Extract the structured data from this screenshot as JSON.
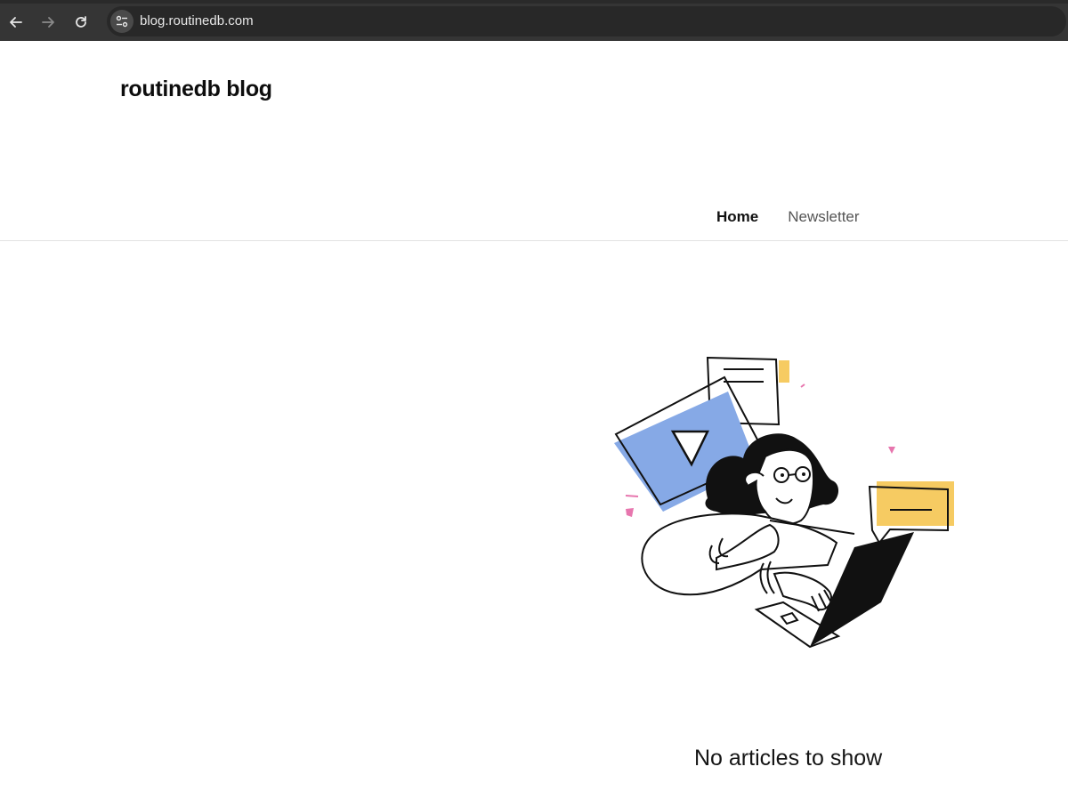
{
  "browser": {
    "url": "blog.routinedb.com",
    "back_icon": "arrow-left-icon",
    "forward_icon": "arrow-right-icon",
    "reload_icon": "reload-icon",
    "site_info_icon": "tune-icon"
  },
  "header": {
    "title": "routinedb blog",
    "nav": [
      {
        "label": "Home",
        "active": true
      },
      {
        "label": "Newsletter",
        "active": false
      }
    ]
  },
  "main": {
    "empty_message": "No articles to show",
    "illustration_icon": "person-with-laptop-illustration"
  },
  "colors": {
    "accent_blue": "#86A9E6",
    "accent_yellow": "#F6CB62",
    "accent_pink": "#E776AE"
  }
}
